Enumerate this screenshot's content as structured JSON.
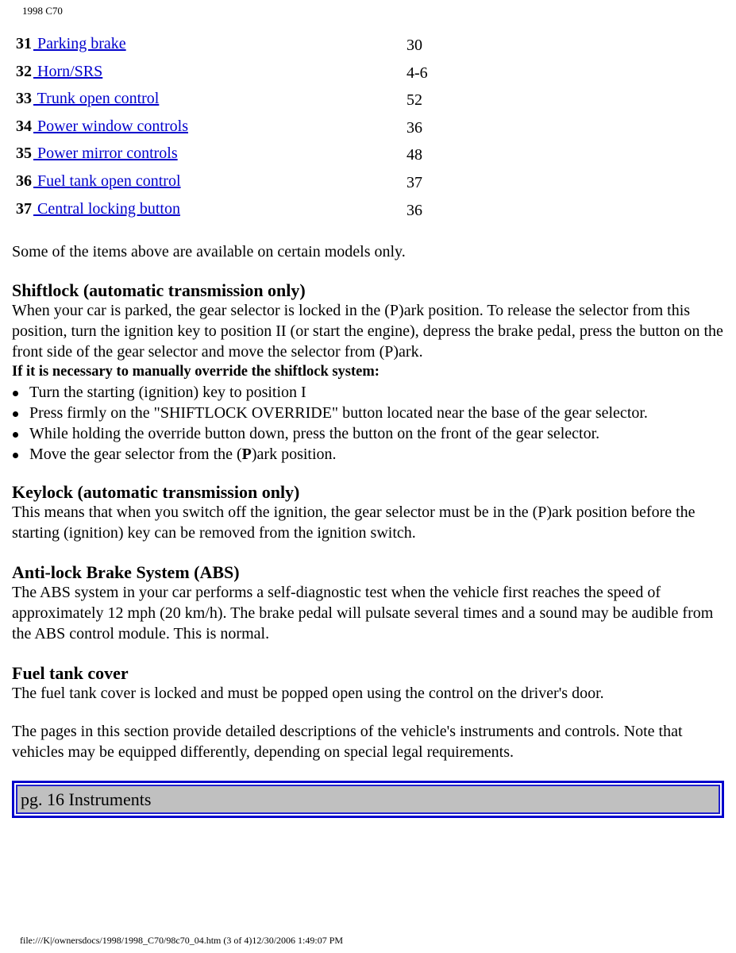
{
  "header": {
    "title": "1998 C70"
  },
  "items": [
    {
      "num": "31",
      "label": " Parking brake",
      "page": "30"
    },
    {
      "num": "32",
      "label": " Horn/SRS",
      "page": "4-6"
    },
    {
      "num": "33",
      "label": " Trunk open control",
      "page": "52"
    },
    {
      "num": "34",
      "label": " Power window controls",
      "page": "36"
    },
    {
      "num": "35",
      "label": " Power mirror controls",
      "page": "48"
    },
    {
      "num": "36",
      "label": " Fuel tank open control",
      "page": "37"
    },
    {
      "num": "37",
      "label": " Central locking button",
      "page": "36"
    }
  ],
  "note": "Some of the items above are available on certain models only.",
  "shiftlock": {
    "heading": "Shiftlock (automatic transmission only)",
    "body": "When your car is parked, the gear selector is locked in the (P)ark position. To release the selector from this position, turn the ignition key to position II (or start the engine), depress the brake pedal, press the button on the front side of the gear selector and move the selector from (P)ark.",
    "override_heading": "If it is necessary to manually override the shiftlock system:",
    "steps": [
      "Turn the starting (ignition) key to position I",
      "Press firmly on the \"SHIFTLOCK OVERRIDE\" button located near the base of the gear selector.",
      "While holding the override button down, press the button on the front of the gear selector."
    ],
    "last_step": {
      "before": "Move the gear selector from the (",
      "bold": "P",
      "after": ")ark position."
    }
  },
  "keylock": {
    "heading": "Keylock (automatic transmission only)",
    "body": "This means that when you switch off the ignition, the gear selector must be in the (P)ark position before the starting (ignition) key can be removed from the ignition switch."
  },
  "abs": {
    "heading": "Anti-lock Brake System (ABS)",
    "body": "The ABS system in your car performs a self-diagnostic test when the vehicle first reaches the speed of approximately 12 mph (20 km/h). The brake pedal will pulsate several times and a sound may be audible from the ABS control module. This is normal."
  },
  "fuel_tank": {
    "heading": "Fuel tank cover",
    "body": "The fuel tank cover is locked and must be popped open using the control on the driver's door."
  },
  "section_intro": "The pages in this section provide detailed descriptions of the vehicle's instruments and controls. Note that vehicles may be equipped differently, depending on special legal requirements.",
  "nav": {
    "label": "pg. 16 Instruments"
  },
  "footer": {
    "text": "file:///K|/ownersdocs/1998/1998_C70/98c70_04.htm (3 of 4)12/30/2006 1:49:07 PM"
  },
  "colors": {
    "link": "#0000cc",
    "nav_border": "#0000cc",
    "nav_background": "#c0c0c0"
  }
}
